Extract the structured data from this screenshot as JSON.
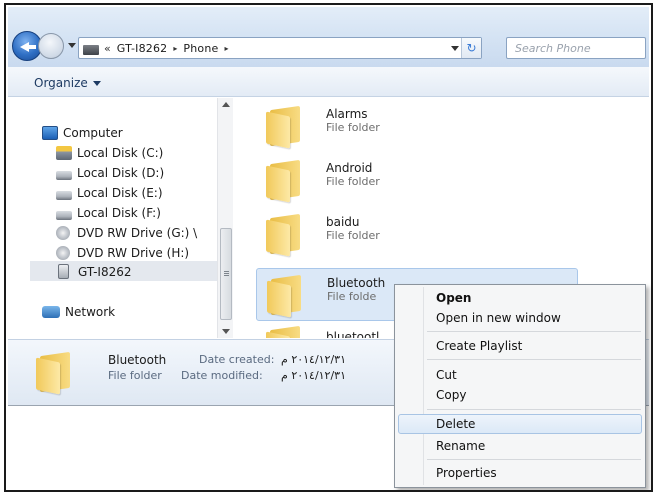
{
  "address": {
    "chevron": "«",
    "crumbs": [
      "GT-I8262",
      "Phone"
    ],
    "separator": "▸",
    "refresh_glyph": "↻"
  },
  "search": {
    "placeholder": "Search Phone"
  },
  "toolbar": {
    "organize_label": "Organize"
  },
  "nav": {
    "computer": "Computer",
    "disk_c": "Local Disk (C:)",
    "disk_d": "Local Disk (D:)",
    "disk_e": "Local Disk (E:)",
    "disk_f": "Local Disk (F:)",
    "dvd_g": "DVD RW Drive (G:) \\",
    "dvd_h": "DVD RW Drive (H:)",
    "gt": "GT-I8262",
    "network": "Network"
  },
  "files": [
    {
      "name": "Alarms",
      "type": "File folder"
    },
    {
      "name": "Android",
      "type": "File folder"
    },
    {
      "name": "baidu",
      "type": "File folder"
    },
    {
      "name": "Bluetooth",
      "type": "File folde"
    },
    {
      "name": "bluetootl",
      "type": ""
    }
  ],
  "details": {
    "name": "Bluetooth",
    "type": "File folder",
    "created_label": "Date created:",
    "created_value": "٢٠١٤/١٢/٣١ م",
    "modified_label": "Date modified:",
    "modified_value": "٢٠١٤/١٢/٣١ م"
  },
  "context_menu": {
    "open": "Open",
    "open_new_window": "Open in new window",
    "create_playlist": "Create Playlist",
    "cut": "Cut",
    "copy": "Copy",
    "delete": "Delete",
    "rename": "Rename",
    "properties": "Properties"
  },
  "icons": {
    "back": "back-arrow-icon",
    "forward": "forward-arrow-icon",
    "folder": "folder-icon",
    "computer": "computer-icon",
    "disk": "hard-disk-icon",
    "dvd": "dvd-drive-icon",
    "phone": "phone-device-icon",
    "network": "network-icon"
  },
  "colors": {
    "selection": "#dbe8f7",
    "titlebar": "#d6e4f4",
    "menu_hover": "#dce9f7"
  }
}
